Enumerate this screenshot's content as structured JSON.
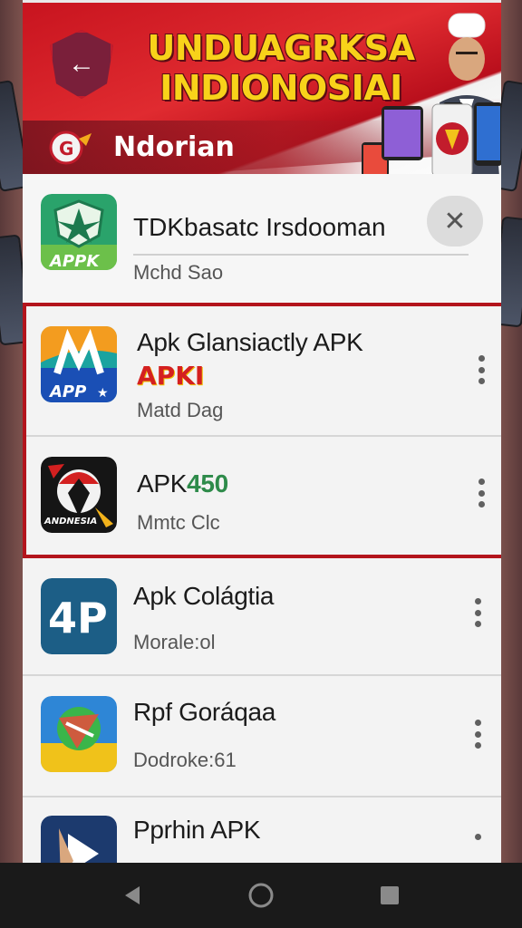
{
  "banner": {
    "title": "UNDUAGRKSA INDIONOSIAI",
    "subtitle": "Ndorian"
  },
  "search": {
    "value": "TDKbasatc Irsdooman",
    "meta": "Mchd Sao",
    "clear_icon": "close-icon",
    "icon_label": "APPK"
  },
  "apps": [
    {
      "title": "Apk Glansiactly APK",
      "badge": "APKI",
      "subtitle": "Matd Dag",
      "icon_label": "APP"
    },
    {
      "title": "APK",
      "badge": "450",
      "subtitle": "Mmtc Clc",
      "icon_label": "ANDNESIA"
    },
    {
      "title": "Apk Colágtia",
      "subtitle": "Morale:ol",
      "icon_label": "4P"
    },
    {
      "title": "Rpf Goráqaa",
      "subtitle": "Dodroke:61"
    },
    {
      "title": "Pprhin APK"
    }
  ],
  "colors": {
    "accent": "#b3141c",
    "banner_yellow": "#f8d21a",
    "navbar": "#1a1a1a"
  },
  "navbar": {
    "back_icon": "back-triangle-icon",
    "home_icon": "home-circle-icon",
    "recent_icon": "recent-square-icon"
  }
}
